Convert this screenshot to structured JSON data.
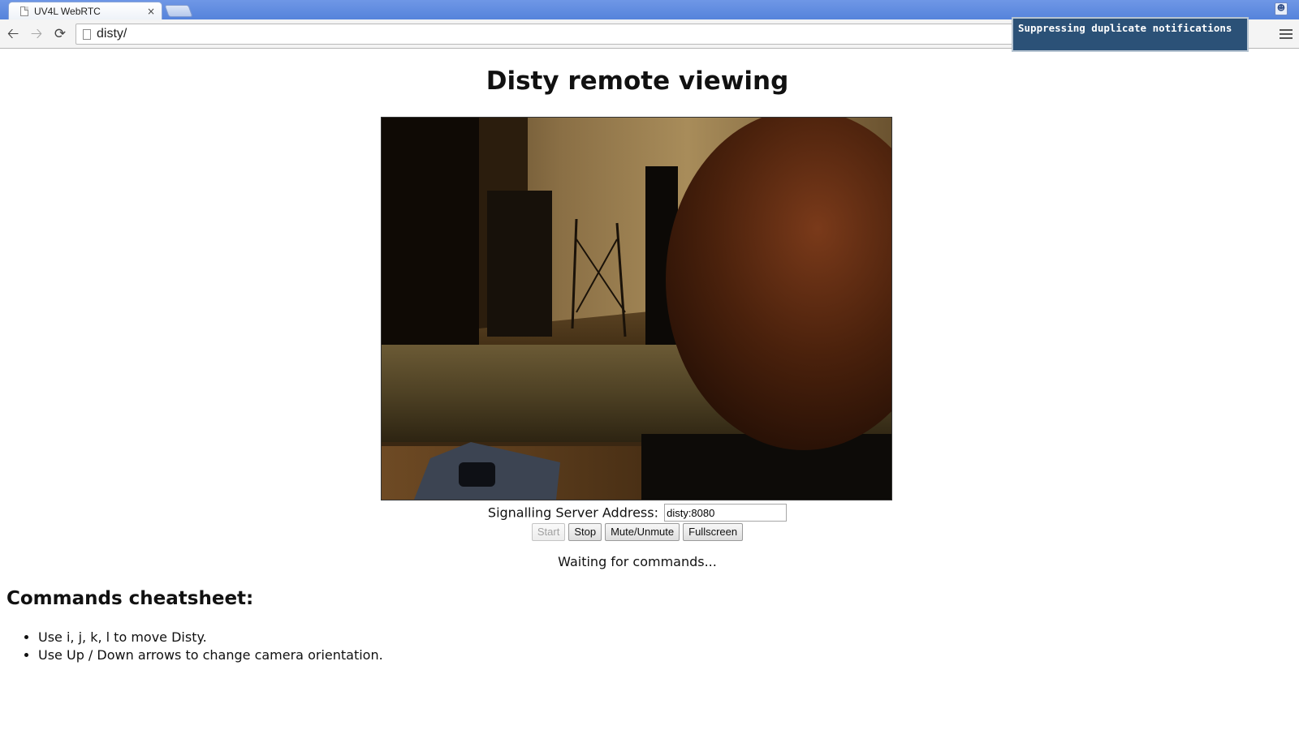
{
  "browser": {
    "tab": {
      "title": "UV4L WebRTC",
      "close_glyph": "×",
      "favicon": "page-icon"
    },
    "address": "disty/",
    "notification": "Suppressing duplicate notifications"
  },
  "page": {
    "title": "Disty remote viewing",
    "video": {
      "description_icon": "video-stream"
    },
    "signalling": {
      "label": "Signalling Server Address:",
      "value": "disty:8080"
    },
    "buttons": {
      "start": "Start",
      "stop": "Stop",
      "mute": "Mute/Unmute",
      "fullscreen": "Fullscreen"
    },
    "status": "Waiting for commands...",
    "cheatsheet": {
      "heading": "Commands cheatsheet:",
      "items": [
        "Use i, j, k, l to move Disty.",
        "Use Up / Down arrows to change camera orientation."
      ]
    }
  },
  "colors": {
    "tabbar": "#5583db",
    "notification_bg": "#2b5177"
  }
}
